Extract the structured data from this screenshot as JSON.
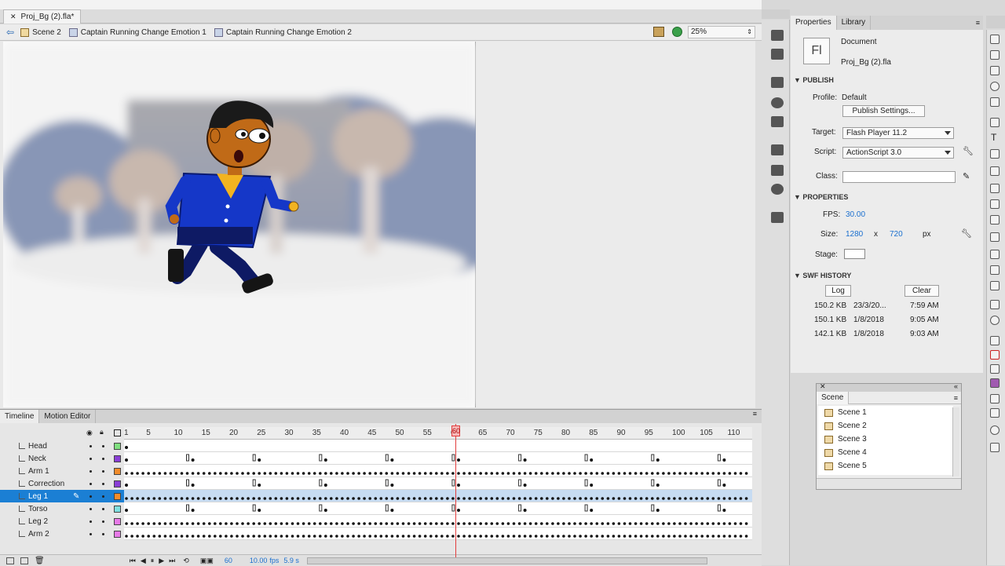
{
  "document": {
    "tab_title": "Proj_Bg (2).fla*",
    "breadcrumbs": [
      "Scene 2",
      "Captain Running Change Emotion 1",
      "Captain Running Change Emotion 2"
    ],
    "zoom": "25%"
  },
  "timeline": {
    "tabs": [
      "Timeline",
      "Motion Editor"
    ],
    "ruler_ticks": [
      "1",
      "5",
      "10",
      "15",
      "20",
      "25",
      "30",
      "35",
      "40",
      "45",
      "50",
      "55",
      "60",
      "65",
      "70",
      "75",
      "80",
      "85",
      "90",
      "95",
      "100",
      "105",
      "110"
    ],
    "layers": [
      {
        "name": "Head",
        "color": "#7fe07f"
      },
      {
        "name": "Neck",
        "color": "#8a3fd6"
      },
      {
        "name": "Arm 1",
        "color": "#f28c2b"
      },
      {
        "name": "Correction",
        "color": "#8a3fd6"
      },
      {
        "name": "Leg 1",
        "color": "#f28c2b",
        "selected": true
      },
      {
        "name": "Torso",
        "color": "#7fe0e0"
      },
      {
        "name": "Leg 2",
        "color": "#e87ae8"
      },
      {
        "name": "Arm 2",
        "color": "#e87ae8"
      }
    ],
    "current_frame": "60",
    "playhead_label": "60",
    "fps": "10.00",
    "fps_unit": "fps",
    "time": "5.9 s"
  },
  "properties": {
    "tabs": [
      "Properties",
      "Library"
    ],
    "doc_type": "Document",
    "doc_name": "Proj_Bg (2).fla",
    "doc_icon_text": "Fl",
    "publish": {
      "section": "PUBLISH",
      "profile_label": "Profile:",
      "profile": "Default",
      "settings_btn": "Publish Settings...",
      "target_label": "Target:",
      "target": "Flash Player 11.2",
      "script_label": "Script:",
      "script": "ActionScript 3.0",
      "class_label": "Class:"
    },
    "props": {
      "section": "PROPERTIES",
      "fps_label": "FPS:",
      "fps": "30.00",
      "size_label": "Size:",
      "width": "1280",
      "x": "x",
      "height": "720",
      "unit": "px",
      "stage_label": "Stage:"
    },
    "history": {
      "section": "SWF HISTORY",
      "log_btn": "Log",
      "clear_btn": "Clear",
      "rows": [
        {
          "size": "150.2 KB",
          "date": "23/3/20...",
          "time": "7:59 AM"
        },
        {
          "size": "150.1 KB",
          "date": "1/8/2018",
          "time": "9:05 AM"
        },
        {
          "size": "142.1 KB",
          "date": "1/8/2018",
          "time": "9:03 AM"
        }
      ]
    }
  },
  "scene_panel": {
    "title": "Scene",
    "scenes": [
      "Scene 1",
      "Scene 2",
      "Scene 3",
      "Scene 4",
      "Scene 5"
    ]
  }
}
